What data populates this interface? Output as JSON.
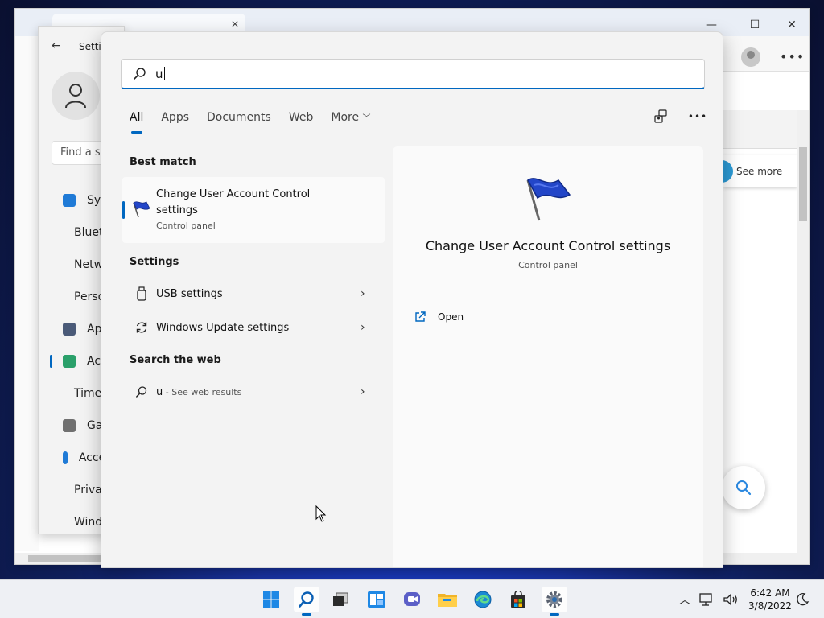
{
  "browser": {
    "tab_close": "✕",
    "window_controls": [
      "—",
      "☐",
      "✕"
    ],
    "menu_dots": "•••",
    "see_more": "See more"
  },
  "settings_window": {
    "title": "Settings",
    "find_placeholder": "Find a setting",
    "nav": [
      {
        "label": "System",
        "color": "#1f7ad6"
      },
      {
        "label": "Bluetooth & devices",
        "color": "#1f7ad6"
      },
      {
        "label": "Network & internet",
        "color": "#2a88e0"
      },
      {
        "label": "Personalization",
        "color": "#d4773a"
      },
      {
        "label": "Apps",
        "color": "#4a5a78"
      },
      {
        "label": "Accounts",
        "color": "#2aa06a"
      },
      {
        "label": "Time & language",
        "color": "#2a88e0"
      },
      {
        "label": "Gaming",
        "color": "#707070"
      },
      {
        "label": "Accessibility",
        "color": "#1f7ad6"
      },
      {
        "label": "Privacy & security",
        "color": "#6d6d6d"
      },
      {
        "label": "Windows Update",
        "color": "#1f7ad6"
      }
    ],
    "active_index": 5
  },
  "search": {
    "query": "u",
    "tabs": [
      "All",
      "Apps",
      "Documents",
      "Web",
      "More"
    ],
    "selected_tab": "All",
    "sections": {
      "best_match": "Best match",
      "settings": "Settings",
      "web": "Search the web"
    },
    "best_match": {
      "title": "Change User Account Control settings",
      "subtitle": "Control panel"
    },
    "settings_results": [
      {
        "label": "USB settings",
        "icon": "usb-icon"
      },
      {
        "label": "Windows Update settings",
        "icon": "refresh-icon"
      }
    ],
    "web_result": {
      "query": "u",
      "suffix": " - See web results"
    },
    "preview": {
      "title": "Change User Account Control settings",
      "subtitle": "Control panel",
      "action": "Open"
    }
  },
  "taskbar": {
    "apps": [
      "start",
      "search",
      "task-view",
      "widgets",
      "chat",
      "file-explorer",
      "edge",
      "store",
      "settings"
    ],
    "time": "6:42 AM",
    "date": "3/8/2022"
  },
  "colors": {
    "accent": "#0067c0",
    "flag_blue": "#2346c8"
  }
}
